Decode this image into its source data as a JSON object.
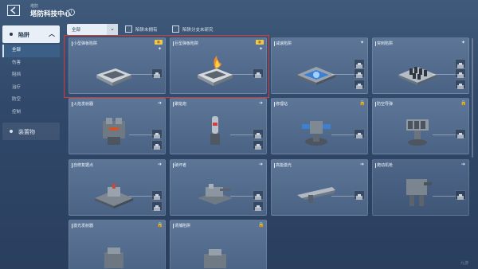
{
  "header": {
    "subtitle": "塔防",
    "title": "塔防科技中心",
    "info_icon": "i"
  },
  "sidebar": {
    "main_category": "陷阱",
    "sub_items": [
      "全部",
      "伤害",
      "阻挡",
      "治疗",
      "防空",
      "控制"
    ],
    "active_index": 0,
    "second_category": "装置物"
  },
  "filter": {
    "select_value": "全部",
    "checkbox_1": "陷阱未拥有",
    "checkbox_2": "陷阱分支未研究"
  },
  "cards": [
    {
      "name": "小型弹板陷阱",
      "tag": "新",
      "art": "pad"
    },
    {
      "name": "巨型弹板陷阱",
      "tag": "新",
      "art": "pad-fire"
    },
    {
      "name": "减速陷阱",
      "tag": "",
      "art": "slow"
    },
    {
      "name": "突刺陷阱",
      "tag": "",
      "art": "spike"
    },
    {
      "name": "火焰发射器",
      "tag": "",
      "art": "flame"
    },
    {
      "name": "聚能炮",
      "tag": "",
      "art": "cannon"
    },
    {
      "name": "修理站",
      "tag": "",
      "art": "repair"
    },
    {
      "name": "防空导弹",
      "tag": "",
      "art": "missile"
    },
    {
      "name": "自修复据点",
      "tag": "",
      "art": "base"
    },
    {
      "name": "破坏者",
      "tag": "",
      "art": "destroyer"
    },
    {
      "name": "高能激光",
      "tag": "",
      "art": "laser"
    },
    {
      "name": "爬动机枪",
      "tag": "",
      "art": "crawler"
    },
    {
      "name": "激光发射器",
      "tag": "",
      "art": "laser2"
    },
    {
      "name": "诱捕陷阱",
      "tag": "",
      "art": "trap"
    }
  ],
  "watermark": "九游"
}
